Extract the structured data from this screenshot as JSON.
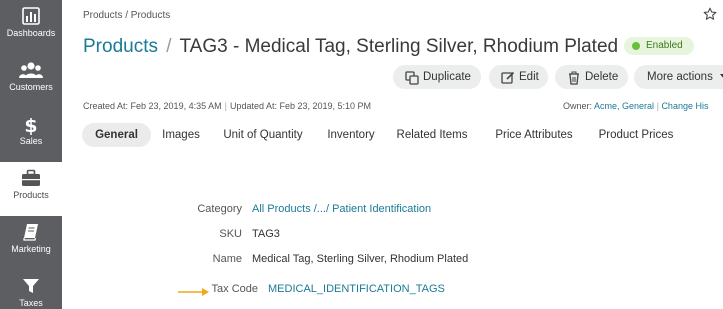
{
  "sidebar": {
    "items": [
      {
        "label": "Dashboards",
        "icon": "bar-chart-icon"
      },
      {
        "label": "Customers",
        "icon": "users-icon"
      },
      {
        "label": "Sales",
        "icon": "dollar-icon"
      },
      {
        "label": "Products",
        "icon": "briefcase-icon"
      },
      {
        "label": "Marketing",
        "icon": "book-icon"
      },
      {
        "label": "Taxes",
        "icon": "filter-icon"
      }
    ],
    "active": "Products"
  },
  "breadcrumb": "Products / Products",
  "header": {
    "title_link": "Products",
    "separator": "/",
    "title": "TAG3 - Medical Tag, Sterling Silver, Rhodium Plated",
    "status": "Enabled"
  },
  "actions": {
    "duplicate": "Duplicate",
    "edit": "Edit",
    "delete": "Delete",
    "more": "More actions"
  },
  "meta": {
    "created": "Created At: Feb 23, 2019, 4:35 AM",
    "separator": "|",
    "updated": "Updated At: Feb 23, 2019, 5:10 PM",
    "owner_label": "Owner:",
    "owner_value": "Acme, General",
    "change_link": "Change His"
  },
  "tabs": [
    "General",
    "Images",
    "Unit of Quantity",
    "Inventory",
    "Related Items",
    "Price Attributes",
    "Product Prices"
  ],
  "fields": {
    "category": {
      "label": "Category",
      "value": "All Products /.../ Patient Identification"
    },
    "sku": {
      "label": "SKU",
      "value": "TAG3"
    },
    "name": {
      "label": "Name",
      "value": "Medical Tag, Sterling Silver, Rhodium Plated"
    },
    "tax_code": {
      "label": "Tax Code",
      "value": "MEDICAL_IDENTIFICATION_TAGS"
    }
  },
  "colors": {
    "sidebar": "#5d5e61",
    "link": "#1b7a96",
    "status_dot": "#67c23a",
    "arrow": "#f0a81a"
  }
}
